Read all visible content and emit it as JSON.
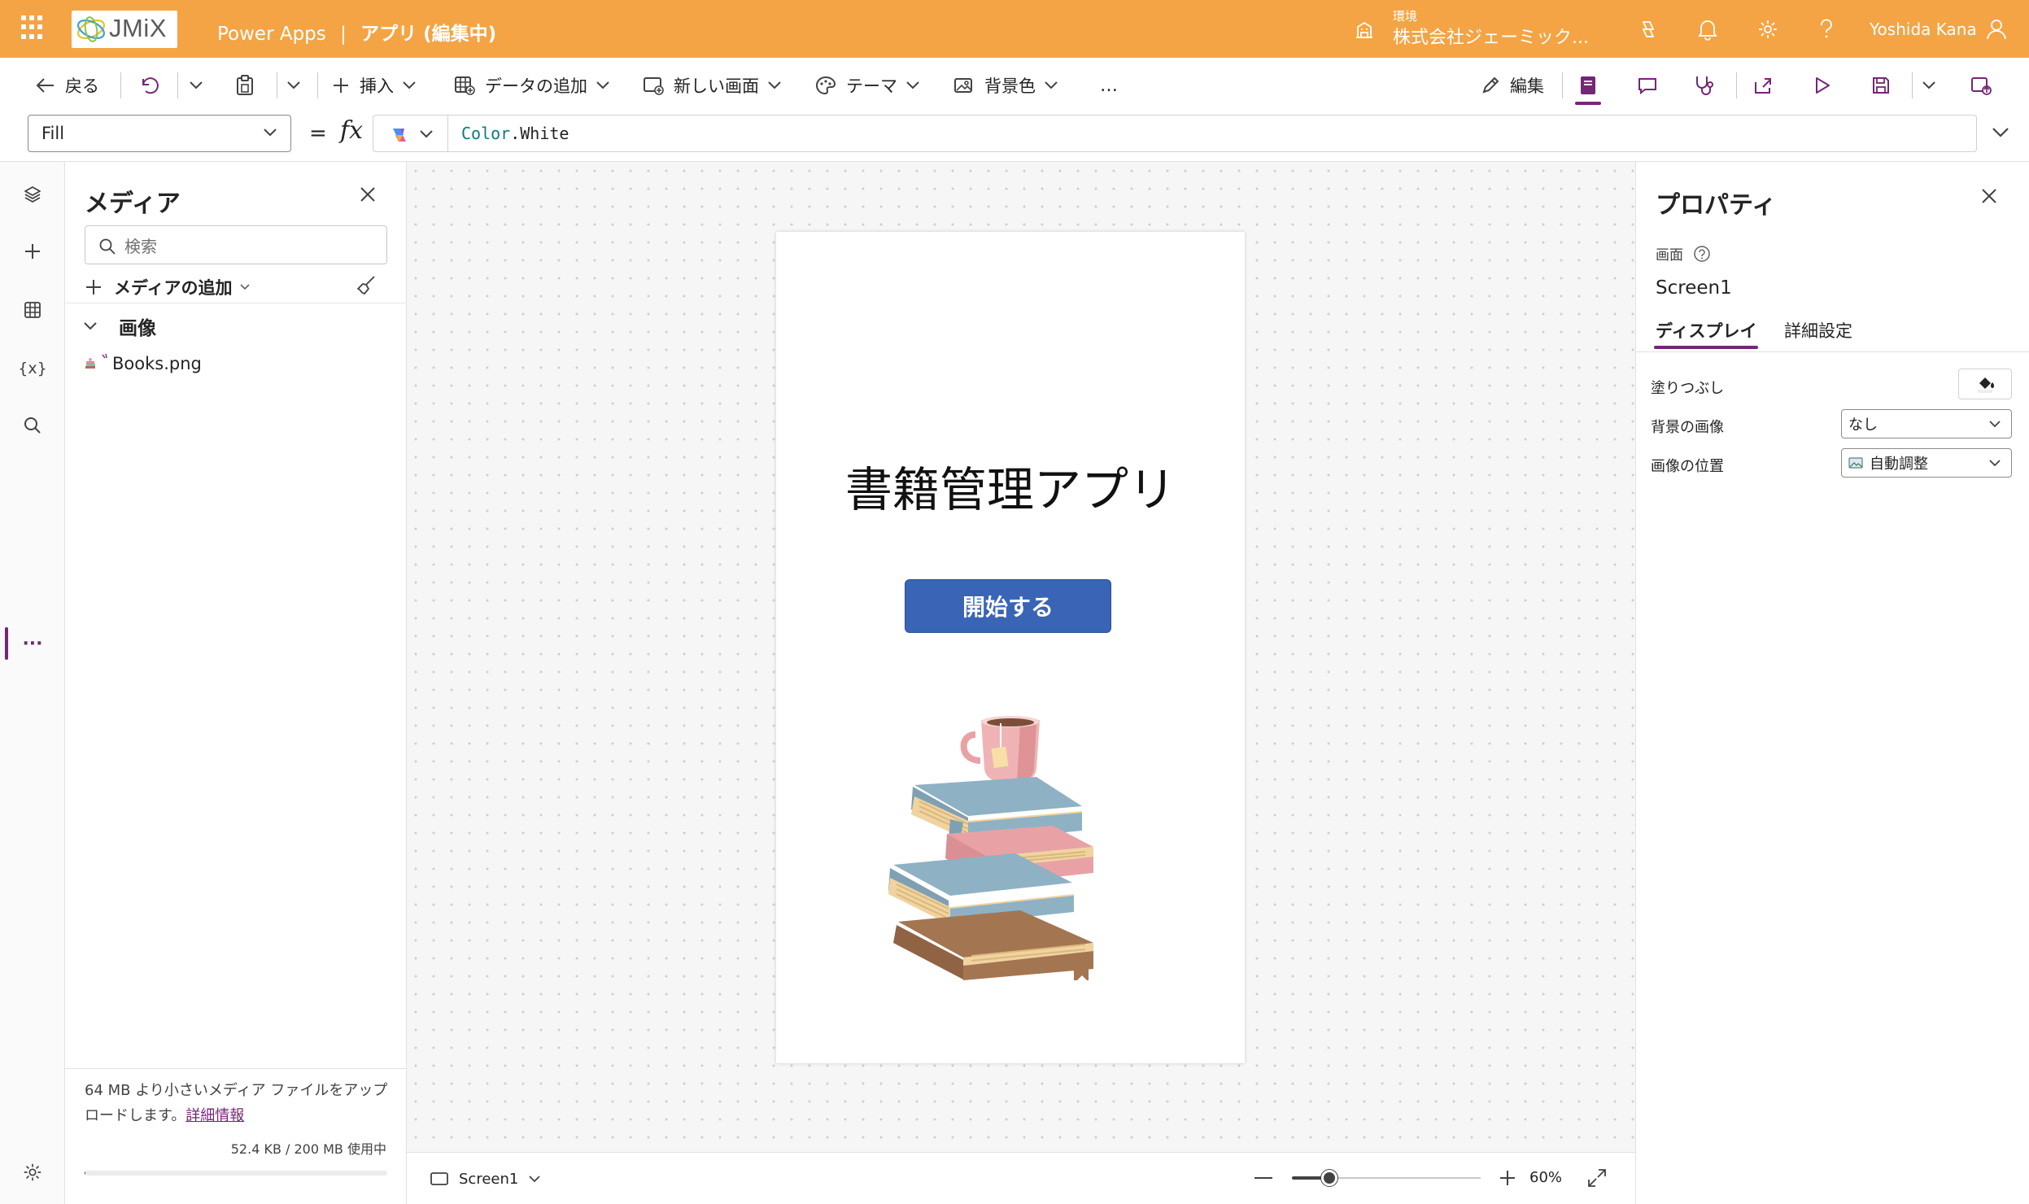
{
  "appbar": {
    "product": "Power Apps",
    "separator": "|",
    "app_title": "アプリ (編集中)",
    "logo_text": "JMiX",
    "environment_label": "環境",
    "environment_name": "株式会社ジェーミック...",
    "user_name": "Yoshida Kana",
    "bg_color": "#f4a444"
  },
  "commandbar": {
    "back": "戻る",
    "insert": "挿入",
    "add_data": "データの追加",
    "new_screen": "新しい画面",
    "theme": "テーマ",
    "background_color": "背景色",
    "more": "…",
    "edit": "編集"
  },
  "formulabar": {
    "property": "Fill",
    "equals": "=",
    "fx": "fx",
    "formula_object": "Color",
    "formula_member": ".White"
  },
  "media_panel": {
    "title": "メディア",
    "search_placeholder": "検索",
    "add_media": "メディアの追加",
    "group_name": "画像",
    "files": [
      "Books.png"
    ],
    "note": "64 MB より小さいメディア ファイルをアップロードします。",
    "note_link": "詳細情報",
    "usage_text": "52.4 KB / 200 MB 使用中",
    "usage_fraction": 0.0003
  },
  "canvas": {
    "app_title": "書籍管理アプリ",
    "start_button": "開始する",
    "button_color": "#3a64b6"
  },
  "statusbar": {
    "screen_name": "Screen1",
    "zoom_label": "60%",
    "zoom_fraction": 0.2
  },
  "properties_panel": {
    "title": "プロパティ",
    "kind": "画面",
    "name": "Screen1",
    "tab_display": "ディスプレイ",
    "tab_advanced": "詳細設定",
    "fill_label": "塗りつぶし",
    "background_image_label": "背景の画像",
    "background_image_value": "なし",
    "image_position_label": "画像の位置",
    "image_position_value": "自動調整"
  },
  "accent_color": "#742774"
}
